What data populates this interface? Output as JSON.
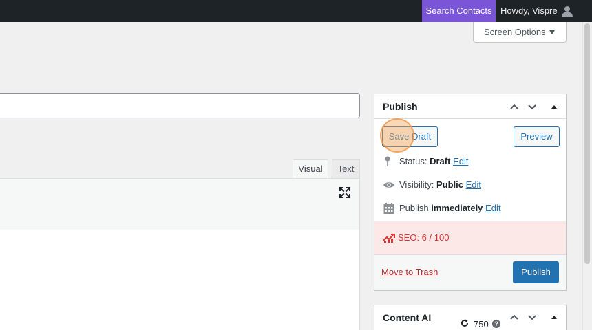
{
  "adminbar": {
    "search_contacts": "Search Contacts",
    "howdy": "Howdy, Vispre",
    "accent_color": "#7b55d8",
    "avatar_icon": "user-avatar-icon"
  },
  "screen_options": {
    "label": "Screen Options"
  },
  "editor": {
    "tabs": [
      {
        "label": "Visual",
        "active": true
      },
      {
        "label": "Text",
        "active": false
      }
    ],
    "fullscreen_icon": "fullscreen-icon"
  },
  "publish": {
    "title": "Publish",
    "save_draft": "Save Draft",
    "preview": "Preview",
    "status_label": "Status:",
    "status_value": "Draft",
    "visibility_label": "Visibility:",
    "visibility_value": "Public",
    "publish_label": "Publish",
    "publish_value": "immediately",
    "edit": "Edit",
    "seo": "SEO: 6 / 100",
    "seo_color": "#dc3232",
    "trash": "Move to Trash",
    "publish_button": "Publish",
    "primary_color": "#2271b1"
  },
  "content_ai": {
    "title": "Content AI",
    "credits": "750",
    "help": "?"
  }
}
